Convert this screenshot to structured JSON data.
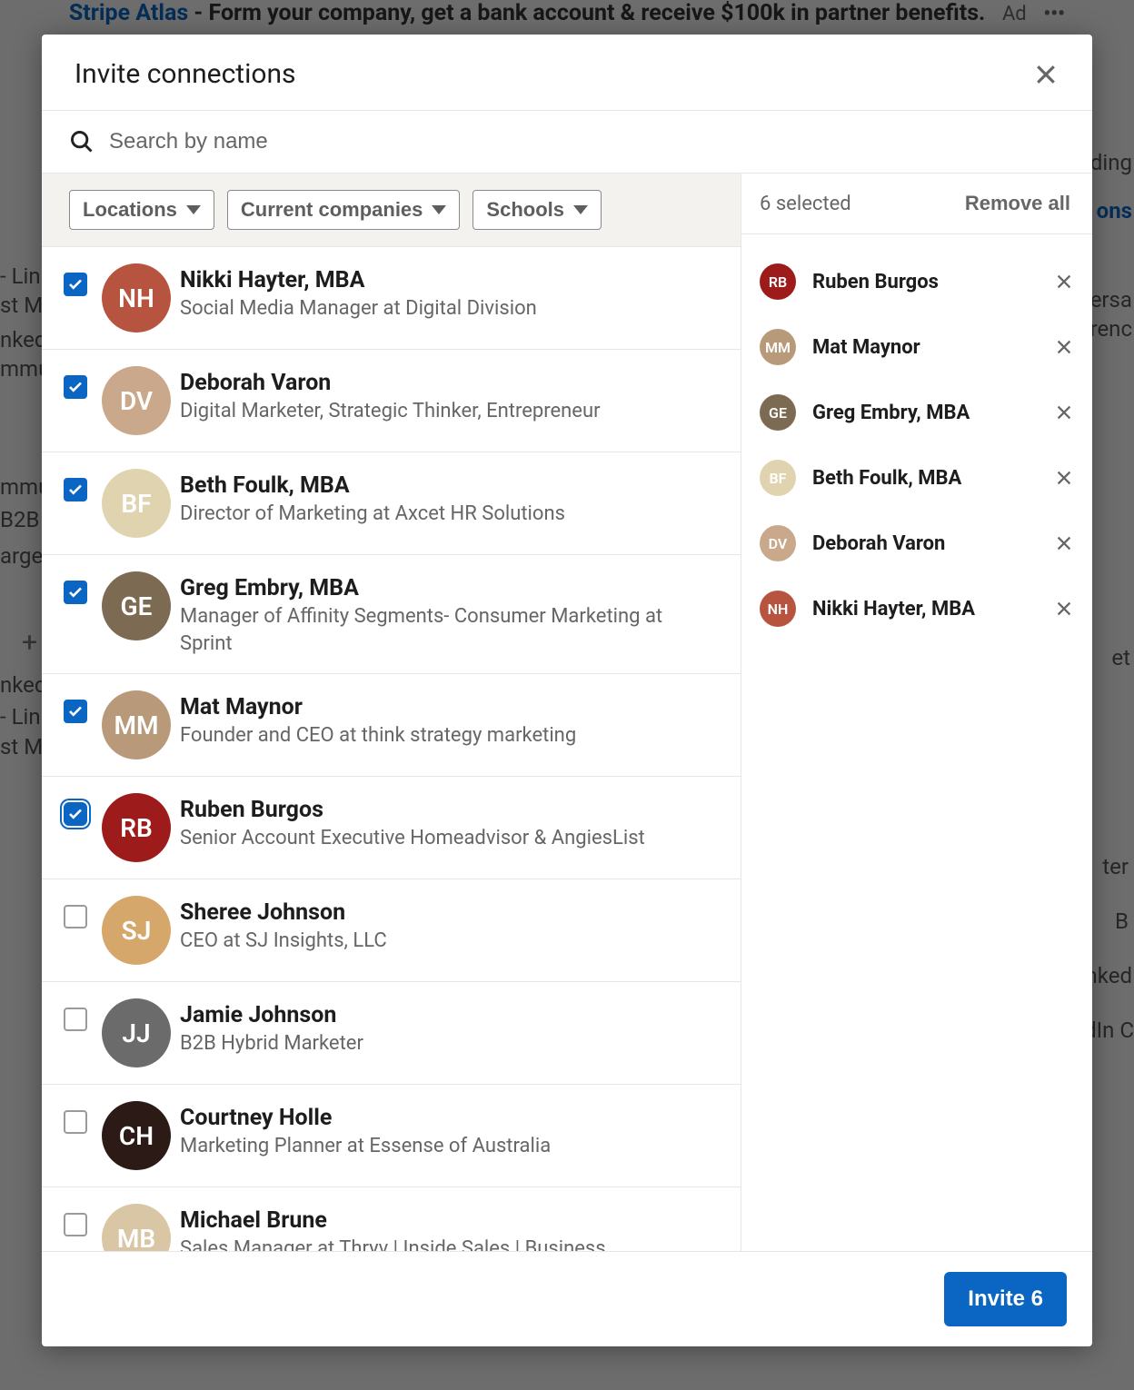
{
  "background": {
    "ad_link_text": "Stripe Atlas",
    "ad_text": " - Form your company, get a bank account & receive $100k in partner benefits.",
    "ad_label": "Ad",
    "snippets": [
      "- Link",
      "st M",
      "nked",
      "mmu",
      "mmu",
      "B2B",
      "arge",
      "nked",
      "- Link",
      "st M",
      "ending",
      "ons",
      "ersa",
      "renc",
      "et",
      "ter",
      "B",
      "nked",
      "dIn C"
    ]
  },
  "modal": {
    "title": "Invite connections",
    "search_placeholder": "Search by name",
    "filters": [
      {
        "label": "Locations"
      },
      {
        "label": "Current companies"
      },
      {
        "label": "Schools"
      }
    ],
    "selected_count_label": "6 selected",
    "remove_all_label": "Remove all",
    "invite_button_label": "Invite 6"
  },
  "connections": [
    {
      "name": "Nikki Hayter, MBA",
      "headline": "Social Media Manager at Digital Division",
      "checked": true,
      "focus": false,
      "avatar_bg": "#b7543f"
    },
    {
      "name": "Deborah Varon",
      "headline": "Digital Marketer, Strategic Thinker, Entrepreneur",
      "checked": true,
      "focus": false,
      "avatar_bg": "#c9a88b"
    },
    {
      "name": "Beth Foulk, MBA",
      "headline": "Director of Marketing at Axcet HR Solutions",
      "checked": true,
      "focus": false,
      "avatar_bg": "#e0d4b0"
    },
    {
      "name": "Greg Embry, MBA",
      "headline": "Manager of Affinity Segments- Consumer Marketing at Sprint",
      "checked": true,
      "focus": false,
      "avatar_bg": "#7c6a53"
    },
    {
      "name": "Mat Maynor",
      "headline": "Founder and CEO at think strategy marketing",
      "checked": true,
      "focus": false,
      "avatar_bg": "#b89a7a"
    },
    {
      "name": "Ruben Burgos",
      "headline": "Senior Account Executive Homeadvisor & AngiesList",
      "checked": true,
      "focus": true,
      "avatar_bg": "#9e1b1b"
    },
    {
      "name": "Sheree Johnson",
      "headline": "CEO at SJ Insights, LLC",
      "checked": false,
      "focus": false,
      "avatar_bg": "#d6a76a"
    },
    {
      "name": "Jamie Johnson",
      "headline": "B2B Hybrid Marketer",
      "checked": false,
      "focus": false,
      "avatar_bg": "#6b6b6b"
    },
    {
      "name": "Courtney Holle",
      "headline": "Marketing Planner at Essense of Australia",
      "checked": false,
      "focus": false,
      "avatar_bg": "#2b1a16"
    },
    {
      "name": "Michael Brune",
      "headline": "Sales Manager at Thryv | Inside Sales | Business",
      "checked": false,
      "focus": false,
      "avatar_bg": "#d9c6a5"
    }
  ],
  "selected": [
    {
      "name": "Ruben Burgos",
      "avatar_bg": "#9e1b1b"
    },
    {
      "name": "Mat Maynor",
      "avatar_bg": "#b89a7a"
    },
    {
      "name": "Greg Embry, MBA",
      "avatar_bg": "#7c6a53"
    },
    {
      "name": "Beth Foulk, MBA",
      "avatar_bg": "#e0d4b0"
    },
    {
      "name": "Deborah Varon",
      "avatar_bg": "#c9a88b"
    },
    {
      "name": "Nikki Hayter, MBA",
      "avatar_bg": "#b7543f"
    }
  ]
}
